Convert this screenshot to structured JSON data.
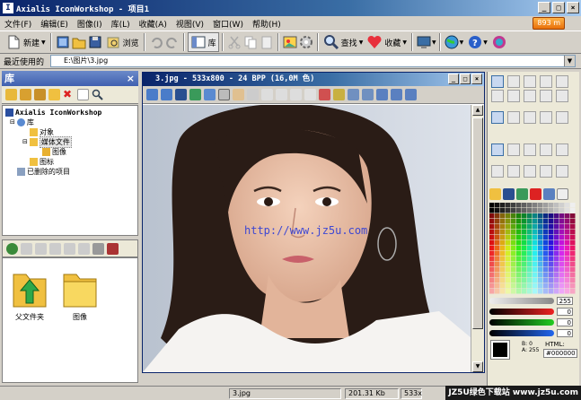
{
  "window": {
    "title": "Axialis IconWorkshop - 项目1",
    "app_icon": "I",
    "promo": "893 m"
  },
  "menu": [
    "文件(F)",
    "编辑(E)",
    "图像(I)",
    "库(L)",
    "收藏(A)",
    "视图(V)",
    "窗口(W)",
    "帮助(H)"
  ],
  "toolbar": {
    "new": "新建",
    "browse": "浏览",
    "library": "库",
    "find": "查找",
    "favorites": "收藏"
  },
  "address": {
    "label": "最近使用的",
    "path": "E:\\图片\\3.jpg"
  },
  "library_panel": {
    "title": "库",
    "close": "×",
    "tree": {
      "root": "Axialis IconWorkshop",
      "library": "库",
      "objects": "对象",
      "media": "媒体文件",
      "images": "图像",
      "icons": "图标",
      "deleted": "已删除的项目"
    },
    "folders": [
      {
        "label": "父文件夹"
      },
      {
        "label": "图像"
      }
    ]
  },
  "document": {
    "title": "3.jpg - 533x800 - 24 BPP (16,0M 色)",
    "watermark": "http://www.jz5u.com"
  },
  "color_panel": {
    "opacity": "255",
    "r": "0",
    "g": "0",
    "b": "0",
    "html_label": "HTML:",
    "html_value": "#000000",
    "b_val": "0",
    "a_val": "255",
    "b_label": "B:",
    "a_label": "A:"
  },
  "status": {
    "file": "3.jpg",
    "size": "201.31 Kb",
    "dims": "533x",
    "brand": "JZ5U绿色下载站 www.jz5u.com"
  }
}
